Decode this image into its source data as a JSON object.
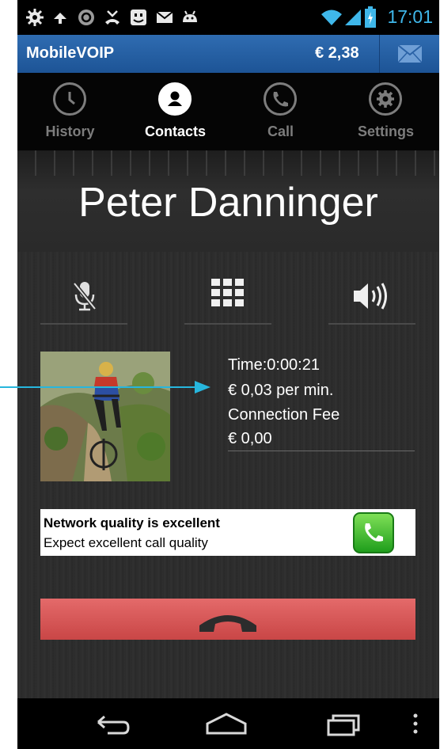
{
  "status_bar": {
    "time": "17:01",
    "left_icons": [
      "settings-icon",
      "usb-icon",
      "sync-icon",
      "missed-call-icon",
      "smiley-icon",
      "mail-icon",
      "android-icon"
    ],
    "right_icons": [
      "wifi-icon",
      "signal-icon",
      "battery-icon"
    ],
    "time_color": "#3fb7ea"
  },
  "app_bar": {
    "title": "MobileVOIP",
    "balance": "€ 2,38",
    "color": "#2a62a6"
  },
  "tabs": [
    {
      "label": "History",
      "icon": "clock-icon",
      "active": false
    },
    {
      "label": "Contacts",
      "icon": "person-icon",
      "active": true
    },
    {
      "label": "Call",
      "icon": "phone-icon",
      "active": false
    },
    {
      "label": "Settings",
      "icon": "gear-icon",
      "active": false
    }
  ],
  "call": {
    "caller_name": "Peter Danninger",
    "controls": [
      "mute-mic-icon",
      "keypad-icon",
      "speaker-icon"
    ],
    "time": "Time:0:00:21",
    "rate": "€ 0,03 per min.",
    "connection_fee_label": "Connection Fee",
    "connection_fee": "€ 0,00"
  },
  "quality": {
    "title": "Network quality is excellent",
    "subtitle": "Expect excellent call quality"
  },
  "hangup": {
    "color": "#d65555",
    "icon": "hang-up-icon"
  },
  "nav_bar": [
    "back-icon",
    "home-icon",
    "recent-apps-icon",
    "overflow-menu-icon"
  ],
  "annotation": {
    "color": "#27b6dd"
  }
}
